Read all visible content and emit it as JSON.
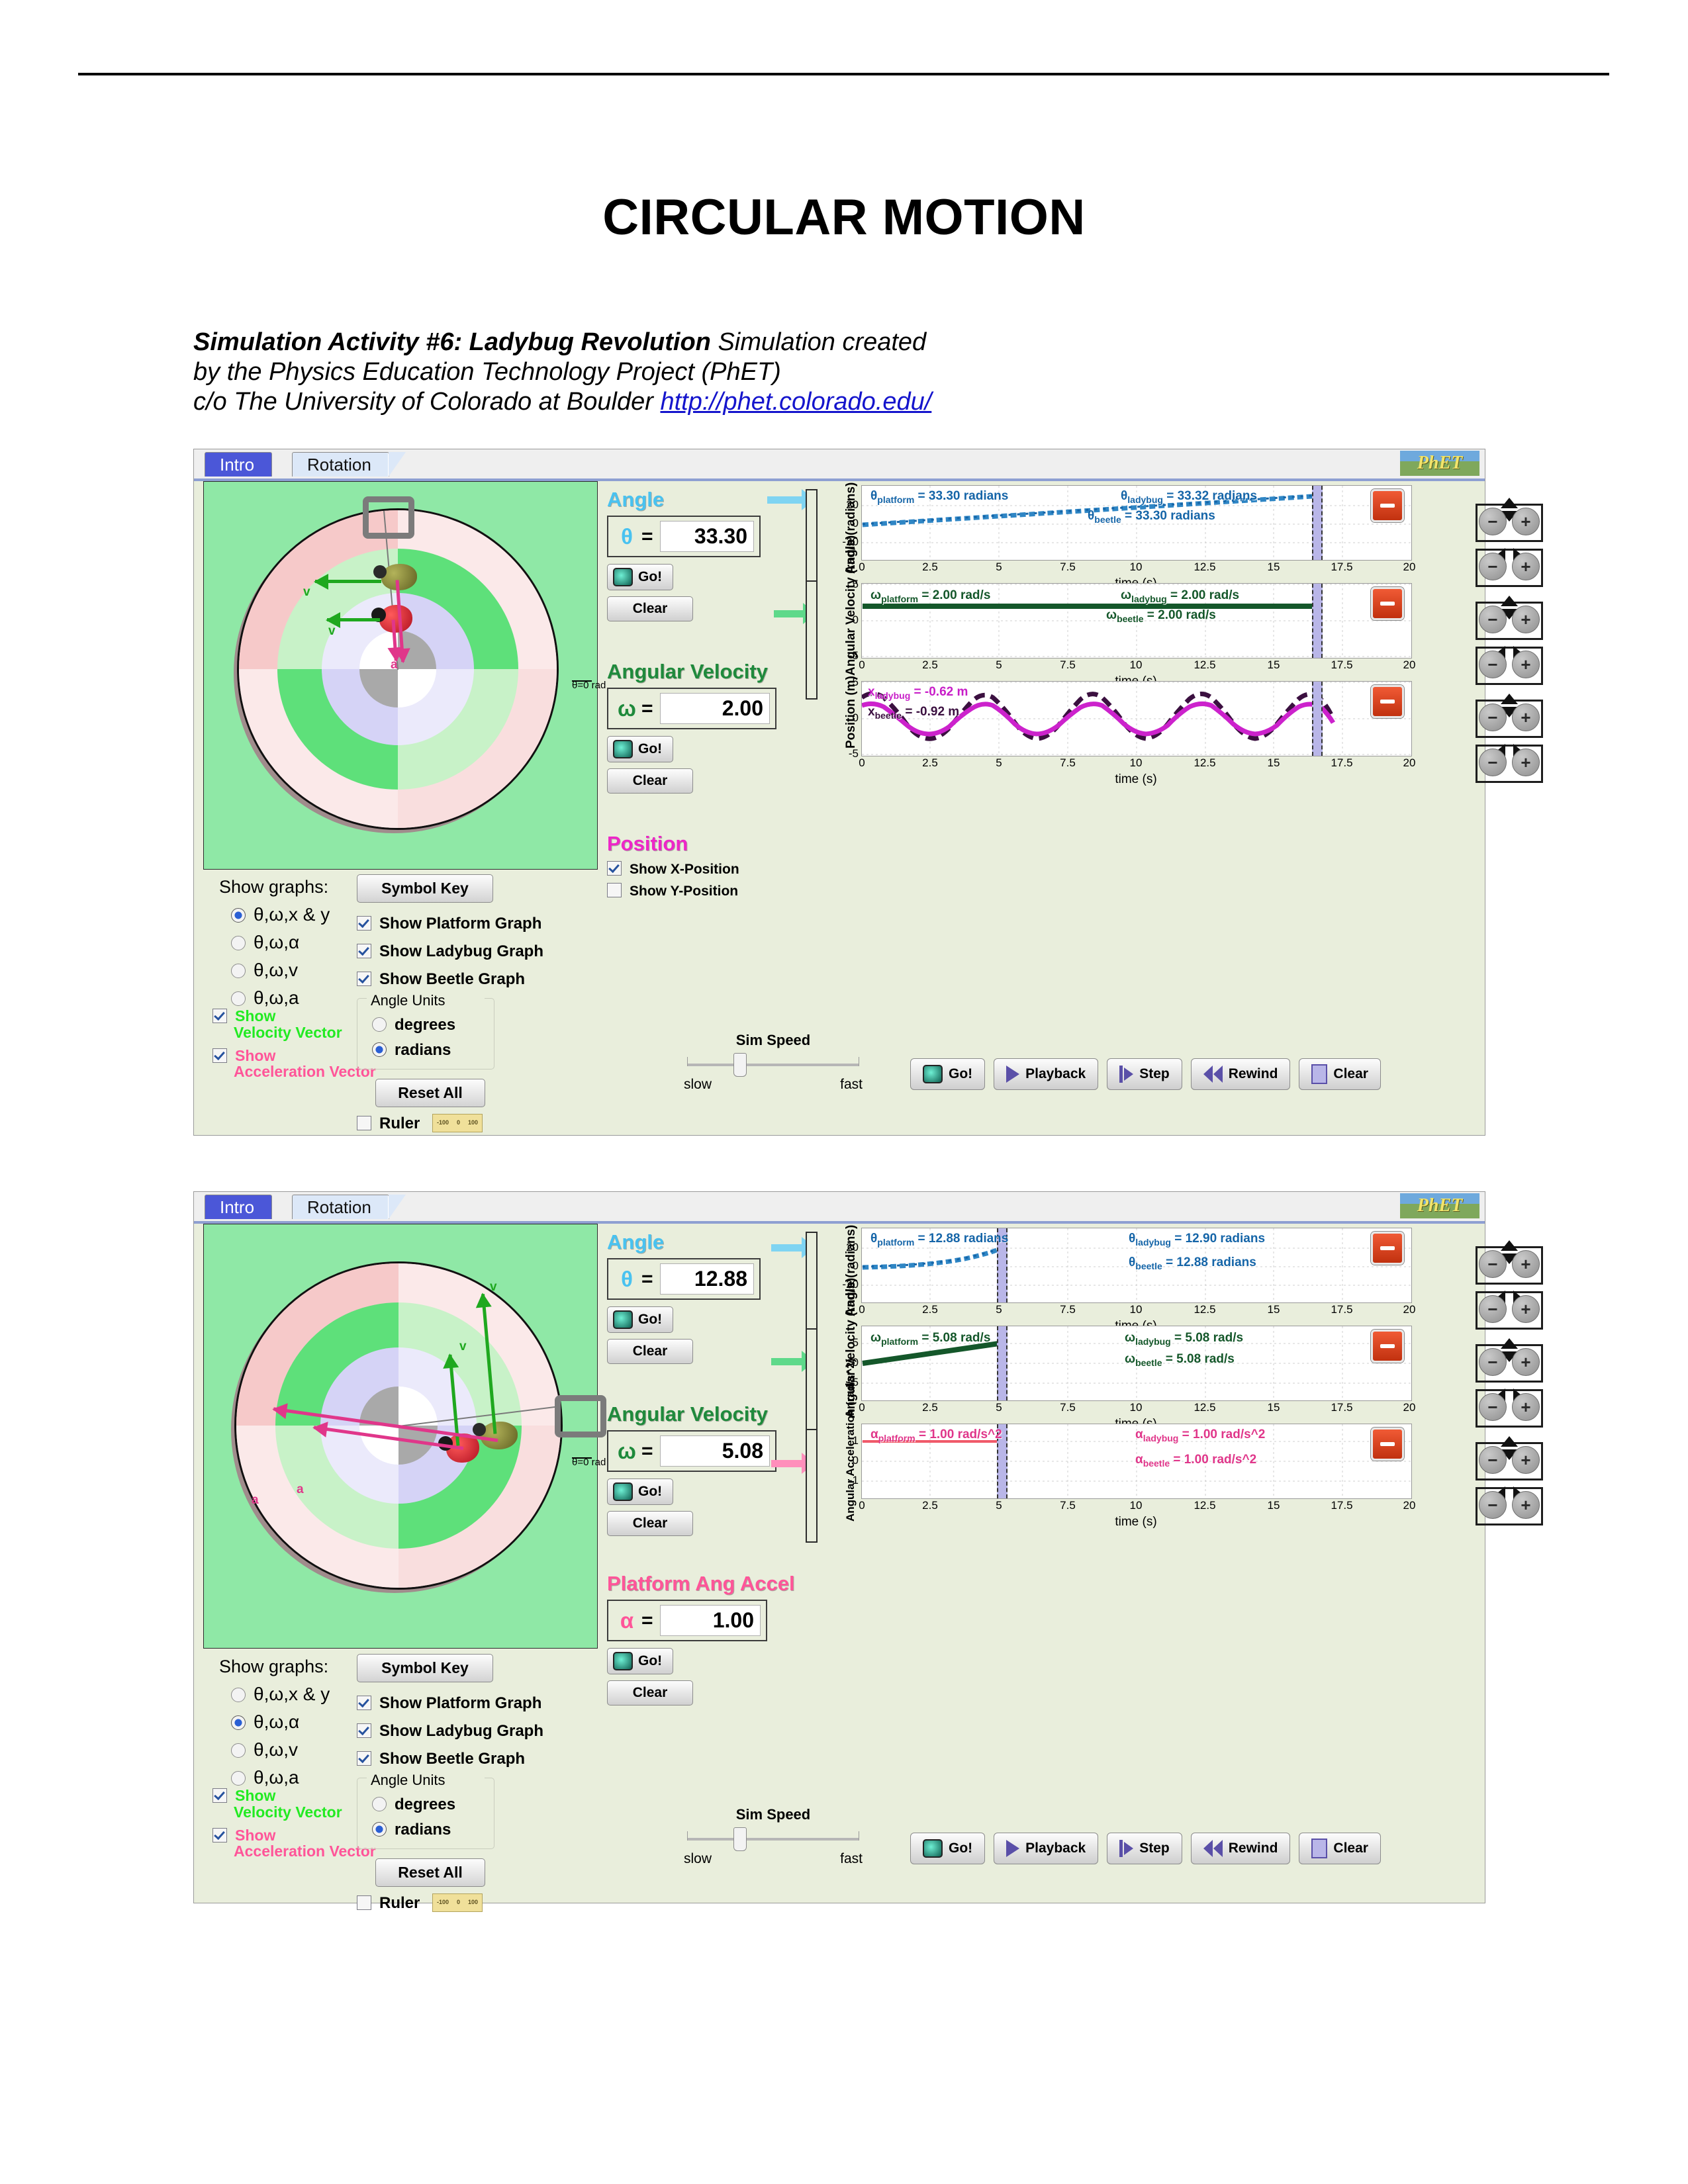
{
  "document": {
    "title": "CIRCULAR MOTION",
    "activity_bold": "Simulation Activity #6: Ladybug Revolution",
    "activity_rest": " Simulation created",
    "line2": "by the Physics Education Technology Project (PhET)",
    "line3_prefix": "c/o The University of Colorado at Boulder ",
    "link_text": "http://phet.colorado.edu/"
  },
  "sim": {
    "tabs": {
      "intro": "Intro",
      "rotation": "Rotation"
    },
    "logo": "PhET",
    "stage": {
      "theta_zero_label": "θ=0 rad",
      "velocity_glyph": "v",
      "accel_glyph": "a"
    },
    "controls": {
      "show_graphs_label": "Show graphs:",
      "symbol_key": "Symbol Key",
      "radio_options": [
        "θ,ω,x & y",
        "θ,ω,α",
        "θ,ω,v",
        "θ,ω,a"
      ],
      "checkboxes": [
        "Show Platform Graph",
        "Show Ladybug Graph",
        "Show Beetle Graph"
      ],
      "angle_units_label": "Angle Units",
      "angle_units_options": [
        "degrees",
        "radians"
      ],
      "reset_all": "Reset All",
      "show_velocity_vector": [
        "Show",
        "Velocity Vector"
      ],
      "show_acceleration_vector": [
        "Show",
        "Acceleration Vector"
      ],
      "ruler_label": "Ruler",
      "ruler_ticks": [
        "-100",
        "0",
        "100"
      ]
    },
    "panel_titles": {
      "angle": "Angle",
      "angular_velocity": "Angular Velocity",
      "position": "Position",
      "platform_ang_accel": "Platform Ang Accel"
    },
    "symbols": {
      "theta": "θ",
      "omega": "ω",
      "alpha": "α",
      "equals": "="
    },
    "buttons": {
      "go": "Go!",
      "clear": "Clear",
      "playback": "Playback",
      "step": "Step",
      "rewind": "Rewind"
    },
    "position_checks": {
      "x": "Show X-Position",
      "y": "Show Y-Position"
    },
    "sim_speed": {
      "title": "Sim Speed",
      "slow": "slow",
      "fast": "fast"
    }
  },
  "screenshot1": {
    "values": {
      "theta": "33.30",
      "omega": "2.00"
    },
    "position_checks": {
      "x_checked": true,
      "y_checked": false
    },
    "selected_graph_mode": 0,
    "angle_units_selected": "radians",
    "show_velocity_vector": true,
    "show_acceleration_vector": true,
    "ruler_checked": false
  },
  "screenshot2": {
    "values": {
      "theta": "12.88",
      "omega": "5.08",
      "alpha": "1.00"
    },
    "selected_graph_mode": 1,
    "angle_units_selected": "radians",
    "show_velocity_vector": true,
    "show_acceleration_vector": true,
    "ruler_checked": false
  },
  "chart_data": [
    {
      "id": "s1-angle",
      "type": "line",
      "title": "",
      "xlabel": "time (s)",
      "ylabel": "Angle (radians)",
      "xlim": [
        0,
        20
      ],
      "ylim": [
        -40,
        40
      ],
      "xticks": [
        "0",
        "2.5",
        "5",
        "7.5",
        "10",
        "12.5",
        "15",
        "17.5",
        "20"
      ],
      "yticks": [
        "20",
        "0",
        "-20"
      ],
      "grid": true,
      "cursor_time": 16.4,
      "annotations": [
        {
          "label": "θ",
          "sub": "platform",
          "text": " = 33.30 radians",
          "color": "#1565a8"
        },
        {
          "label": "θ",
          "sub": "ladybug",
          "text": " = 33.32 radians",
          "color": "#1565a8"
        },
        {
          "label": "θ",
          "sub": "beetle",
          "text": " = 33.30 radians",
          "color": "#1565a8"
        }
      ],
      "series": [
        {
          "name": "platform",
          "color": "#2f86c5",
          "x": [
            0,
            16.4
          ],
          "y": [
            0,
            33.3
          ]
        }
      ]
    },
    {
      "id": "s1-omega",
      "type": "line",
      "title": "",
      "xlabel": "time (s)",
      "ylabel": "Angular Velocity (rad/s)",
      "xlim": [
        0,
        20
      ],
      "ylim": [
        -5,
        5
      ],
      "xticks": [
        "0",
        "2.5",
        "5",
        "7.5",
        "10",
        "12.5",
        "15",
        "17.5",
        "20"
      ],
      "yticks": [
        "5",
        "0",
        "-5"
      ],
      "grid": true,
      "cursor_time": 16.4,
      "annotations": [
        {
          "label": "ω",
          "sub": "platform",
          "text": " = 2.00 rad/s",
          "color": "#14572a"
        },
        {
          "label": "ω",
          "sub": "ladybug",
          "text": " = 2.00 rad/s",
          "color": "#14572a"
        },
        {
          "label": "ω",
          "sub": "beetle",
          "text": " = 2.00 rad/s",
          "color": "#14572a"
        }
      ],
      "series": [
        {
          "name": "platform",
          "color": "#14572a",
          "x": [
            0,
            16.4
          ],
          "y": [
            2.0,
            2.0
          ]
        }
      ]
    },
    {
      "id": "s1-position",
      "type": "line",
      "title": "",
      "xlabel": "time (s)",
      "ylabel": "Position (m)",
      "xlim": [
        0,
        20
      ],
      "ylim": [
        -5,
        5
      ],
      "xticks": [
        "0",
        "2.5",
        "5",
        "7.5",
        "10",
        "12.5",
        "15",
        "17.5",
        "20"
      ],
      "yticks": [
        "5",
        "0",
        "-5"
      ],
      "grid": true,
      "cursor_time": 16.4,
      "annotations": [
        {
          "label": "x",
          "sub": "ladybug",
          "text": " = -0.62 m",
          "color": "#c81ec8"
        },
        {
          "label": "x",
          "sub": "beetle",
          "text": " = -0.92 m",
          "color": "#3b1040"
        }
      ],
      "series": [
        {
          "name": "ladybug",
          "color": "#cc22cc",
          "amplitude": 2.0,
          "period": 3.14,
          "phase": 3.14
        },
        {
          "name": "beetle",
          "color": "#3b1040",
          "amplitude": 3.0,
          "period": 3.14,
          "phase": 3.14,
          "dashed": true
        }
      ]
    },
    {
      "id": "s2-angle",
      "type": "line",
      "title": "",
      "xlabel": "time (s)",
      "ylabel": "Angle (radians)",
      "xlim": [
        0,
        20
      ],
      "ylim": [
        -40,
        40
      ],
      "xticks": [
        "0",
        "2.5",
        "5",
        "7.5",
        "10",
        "12.5",
        "15",
        "17.5",
        "20"
      ],
      "yticks": [
        "20",
        "0",
        "-20"
      ],
      "grid": true,
      "cursor_time": 5.0,
      "annotations": [
        {
          "label": "θ",
          "sub": "platform",
          "text": " = 12.88 radians",
          "color": "#1565a8"
        },
        {
          "label": "θ",
          "sub": "ladybug",
          "text": " = 12.90 radians",
          "color": "#1565a8"
        },
        {
          "label": "θ",
          "sub": "beetle",
          "text": " = 12.88 radians",
          "color": "#1565a8"
        }
      ],
      "series": [
        {
          "name": "platform",
          "color": "#2f86c5",
          "shape": "parabola",
          "t_end": 5.0,
          "y_end": 12.88
        }
      ]
    },
    {
      "id": "s2-omega",
      "type": "line",
      "title": "",
      "xlabel": "time (s)",
      "ylabel": "Angular Velocity (rad/s)",
      "xlim": [
        0,
        20
      ],
      "ylim": [
        -9,
        9
      ],
      "xticks": [
        "0",
        "2.5",
        "5",
        "7.5",
        "10",
        "12.5",
        "15",
        "17.5",
        "20"
      ],
      "yticks": [
        "5",
        "0",
        "-5"
      ],
      "grid": true,
      "cursor_time": 5.0,
      "annotations": [
        {
          "label": "ω",
          "sub": "platform",
          "text": " = 5.08 rad/s",
          "color": "#14572a"
        },
        {
          "label": "ω",
          "sub": "ladybug",
          "text": " = 5.08 rad/s",
          "color": "#14572a"
        },
        {
          "label": "ω",
          "sub": "beetle",
          "text": " = 5.08 rad/s",
          "color": "#14572a"
        }
      ],
      "series": [
        {
          "name": "platform",
          "color": "#14572a",
          "x": [
            0,
            5.0
          ],
          "y": [
            0,
            5.08
          ]
        }
      ]
    },
    {
      "id": "s2-alpha",
      "type": "line",
      "title": "",
      "xlabel": "time (s)",
      "ylabel": "Angular Acceleration (rad/s^2)",
      "xlim": [
        0,
        20
      ],
      "ylim": [
        -2,
        2
      ],
      "xticks": [
        "0",
        "2.5",
        "5",
        "7.5",
        "10",
        "12.5",
        "15",
        "17.5",
        "20"
      ],
      "yticks": [
        "1",
        "0",
        "-1"
      ],
      "grid": true,
      "cursor_time": 5.0,
      "annotations": [
        {
          "label": "α",
          "sub": "platform",
          "text": " = 1.00 rad/s^2",
          "color": "#e0368a"
        },
        {
          "label": "α",
          "sub": "ladybug",
          "text": " = 1.00 rad/s^2",
          "color": "#e0368a"
        },
        {
          "label": "α",
          "sub": "beetle",
          "text": " = 1.00 rad/s^2",
          "color": "#e0368a"
        }
      ],
      "series": [
        {
          "name": "platform",
          "color": "#f05a6a",
          "x": [
            0,
            5.0
          ],
          "y": [
            1.0,
            1.0
          ]
        }
      ]
    }
  ],
  "colors": {
    "angle": "#49c2f0",
    "angular_velocity": "#1f8a3c",
    "position": "#ee26c8",
    "platform_ang_accel": "#ff5599",
    "panel_bg": "#e9eedc",
    "stage_bg": "#8fe8a6",
    "link": "#1414cc"
  }
}
